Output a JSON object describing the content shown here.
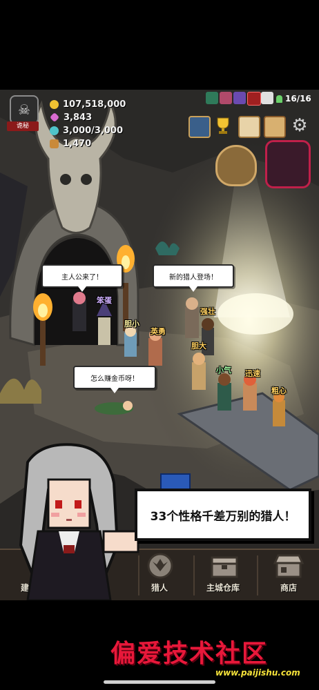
{
  "stats": {
    "gold": "107,518,000",
    "gems": "3,843",
    "mana": "3,000/3,000",
    "scrolls": "1,470"
  },
  "rank_badge": "诡秘",
  "hunters_count": "16/16",
  "bubbles": {
    "master": "主人公来了！",
    "new_hunter": "新的猎人登场！",
    "earn_gold": "怎么赚金币呀！"
  },
  "hunter_names": {
    "clumsy": "笨蛋",
    "timid": "胆小",
    "brave": "英勇",
    "strong": "强壮",
    "bold": "胆大",
    "stingy": "小气",
    "swift": "迅速",
    "careless": "粗心"
  },
  "promo": "33个性格千差万别的猎人！",
  "tabs": {
    "build": "建",
    "hunter": "猎人",
    "warehouse": "主城仓库",
    "shop": "商店"
  },
  "watermark": {
    "title": "偏爱技术社区",
    "url": "www.paijishu.com"
  },
  "icons": {
    "gold": "coin-icon",
    "gems": "gem-icon",
    "mana": "mana-orb-icon",
    "scrolls": "scroll-icon",
    "camera": "camera-icon",
    "trophy": "trophy-icon",
    "letter": "letter-icon",
    "scroll_event": "event-scroll-icon",
    "settings": "gear-icon"
  },
  "colors": {
    "gold": "#f1c232",
    "gem": "#d96bd0",
    "mana": "#4fc3c9",
    "watermark_red": "#e8183a"
  }
}
